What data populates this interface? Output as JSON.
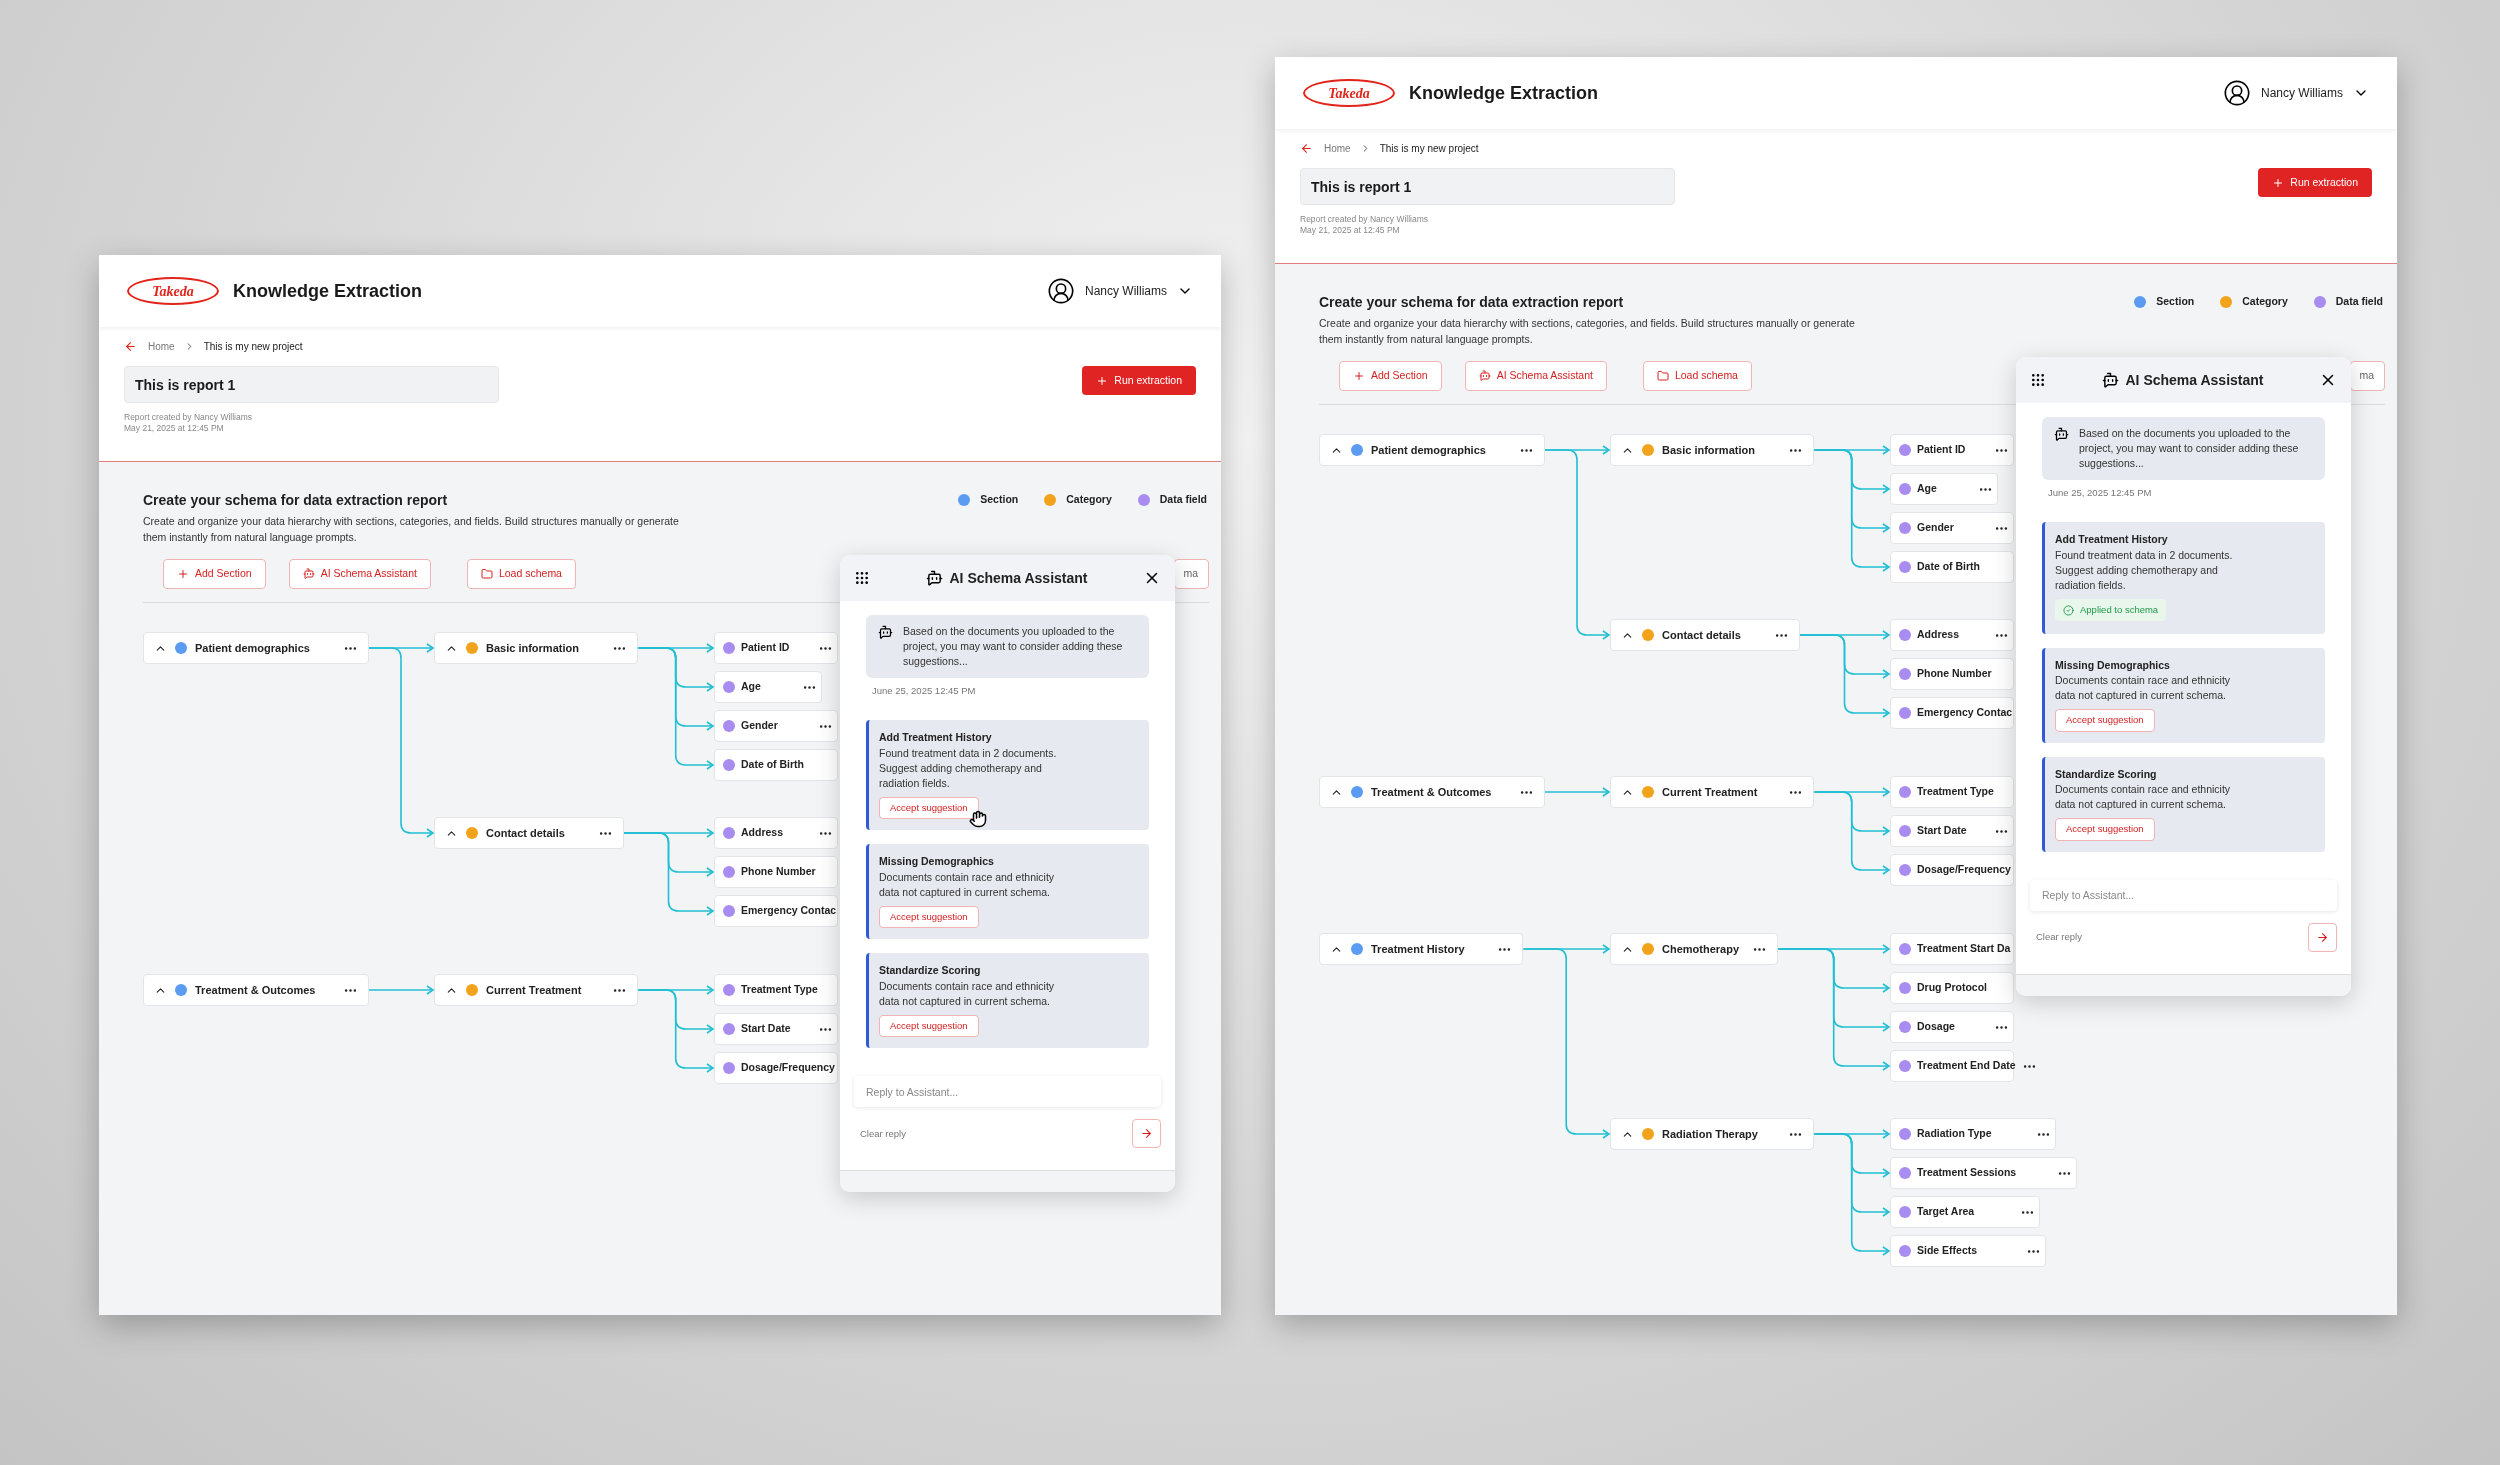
{
  "screens": [
    {
      "logo": "Takeda",
      "app_title": "Knowledge Extraction",
      "user": "Nancy Williams",
      "breadcrumb": [
        "Home",
        "This is my new project"
      ],
      "report_title": "This is report 1",
      "report_meta": [
        "Report created by Nancy Williams",
        "May 21, 2025 at 12:45 PM"
      ],
      "run_button": "Run extraction",
      "schema": {
        "title": "Create your schema for data extraction report",
        "description": "Create and organize your data hierarchy with sections, categories, and fields. Build structures manually or generate them instantly from natural language prompts.",
        "legend": [
          {
            "label": "Section",
            "color": "#5b9cf2"
          },
          {
            "label": "Category",
            "color": "#f2a21b"
          },
          {
            "label": "Data field",
            "color": "#a98cf0"
          }
        ],
        "actions": [
          {
            "kind": "add",
            "label": "Add Section"
          },
          {
            "kind": "assistant",
            "label": "AI Schema Assistant"
          },
          {
            "kind": "load",
            "label": "Load schema"
          },
          {
            "kind": "plain",
            "label": "ma"
          }
        ],
        "tree": [
          {
            "label": "Patient demographics",
            "expanded": true,
            "menu": true,
            "children": [
              {
                "label": "Basic information",
                "expanded": true,
                "menu": true,
                "children": [
                  {
                    "label": "Patient ID",
                    "menu": true
                  },
                  {
                    "label": "Age",
                    "menu": true
                  },
                  {
                    "label": "Gender",
                    "menu": true
                  },
                  {
                    "label": "Date of  Birth",
                    "menu": false
                  }
                ]
              },
              {
                "label": "Contact details",
                "expanded": true,
                "menu": true,
                "children": [
                  {
                    "label": "Address",
                    "menu": true
                  },
                  {
                    "label": "Phone Number",
                    "menu": false
                  },
                  {
                    "label": "Emergency Contac",
                    "menu": false
                  }
                ]
              }
            ]
          },
          {
            "label": "Treatment & Outcomes",
            "expanded": true,
            "menu": true,
            "children": [
              {
                "label": "Current Treatment",
                "expanded": true,
                "menu": true,
                "children": [
                  {
                    "label": "Treatment Type",
                    "menu": false
                  },
                  {
                    "label": "Start Date",
                    "menu": true
                  },
                  {
                    "label": "Dosage/Frequency",
                    "menu": false
                  }
                ]
              }
            ]
          }
        ]
      },
      "assistant": {
        "title": "AI Schema Assistant",
        "message": "Based on the documents you uploaded to the project, you may want to consider adding these suggestions...",
        "time": "June 25, 2025 12:45 PM",
        "suggestions": [
          {
            "title": "Add Treatment History",
            "text": "Found treatment data in 2 documents. Suggest adding chemotherapy and radiation fields.",
            "kind": "accept",
            "action": "Accept suggestion",
            "hovered": true
          },
          {
            "title": "Missing Demographics",
            "text": "Documents contain race and ethnicity data not captured in current schema.",
            "kind": "accept",
            "action": "Accept suggestion",
            "hovered": false
          },
          {
            "title": "Standardize Scoring",
            "text": "Documents contain race and ethnicity data not captured in current schema.",
            "kind": "accept",
            "action": "Accept suggestion",
            "hovered": false
          }
        ],
        "reply_placeholder": "Reply to Assistant...",
        "clear": "Clear reply"
      }
    },
    {
      "logo": "Takeda",
      "app_title": "Knowledge Extraction",
      "user": "Nancy Williams",
      "breadcrumb": [
        "Home",
        "This is my new project"
      ],
      "report_title": "This is report 1",
      "report_meta": [
        "Report created by Nancy Williams",
        "May 21, 2025 at 12:45 PM"
      ],
      "run_button": "Run extraction",
      "schema": {
        "title": "Create your schema for data extraction report",
        "description": "Create and organize your data hierarchy with sections, categories, and fields. Build structures manually or generate them instantly from natural language prompts.",
        "legend": [
          {
            "label": "Section",
            "color": "#5b9cf2"
          },
          {
            "label": "Category",
            "color": "#f2a21b"
          },
          {
            "label": "Data field",
            "color": "#a98cf0"
          }
        ],
        "actions": [
          {
            "kind": "add",
            "label": "Add Section"
          },
          {
            "kind": "assistant",
            "label": "AI Schema Assistant"
          },
          {
            "kind": "load",
            "label": "Load schema"
          },
          {
            "kind": "plain",
            "label": "ma"
          }
        ],
        "tree": [
          {
            "label": "Patient demographics",
            "expanded": true,
            "menu": true,
            "children": [
              {
                "label": "Basic information",
                "expanded": true,
                "menu": true,
                "children": [
                  {
                    "label": "Patient ID",
                    "menu": true
                  },
                  {
                    "label": "Age",
                    "menu": true
                  },
                  {
                    "label": "Gender",
                    "menu": true
                  },
                  {
                    "label": "Date of  Birth",
                    "menu": false
                  }
                ]
              },
              {
                "label": "Contact details",
                "expanded": true,
                "menu": true,
                "children": [
                  {
                    "label": "Address",
                    "menu": true
                  },
                  {
                    "label": "Phone Number",
                    "menu": false
                  },
                  {
                    "label": "Emergency Contac",
                    "menu": false
                  }
                ]
              }
            ]
          },
          {
            "label": "Treatment & Outcomes",
            "expanded": true,
            "menu": true,
            "children": [
              {
                "label": "Current Treatment",
                "expanded": true,
                "menu": true,
                "children": [
                  {
                    "label": "Treatment Type",
                    "menu": false
                  },
                  {
                    "label": "Start Date",
                    "menu": true
                  },
                  {
                    "label": "Dosage/Frequency",
                    "menu": false
                  }
                ]
              }
            ]
          },
          {
            "label": "Treatment History",
            "expanded": true,
            "menu": true,
            "children": [
              {
                "label": "Chemotherapy",
                "expanded": true,
                "menu": true,
                "children": [
                  {
                    "label": "Treatment Start Da",
                    "menu": false
                  },
                  {
                    "label": "Drug Protocol",
                    "menu": false
                  },
                  {
                    "label": "Dosage",
                    "menu": true
                  },
                  {
                    "label": "Treatment End Date",
                    "menu": true
                  }
                ]
              },
              {
                "label": "Radiation Therapy",
                "expanded": true,
                "menu": true,
                "children": [
                  {
                    "label": "Radiation Type",
                    "menu": true
                  },
                  {
                    "label": "Treatment Sessions",
                    "menu": true
                  },
                  {
                    "label": "Target Area",
                    "menu": true
                  },
                  {
                    "label": "Side Effects",
                    "menu": true
                  }
                ]
              }
            ]
          }
        ]
      },
      "assistant": {
        "title": "AI Schema Assistant",
        "message": "Based on the documents you uploaded to the project, you may want to consider adding these suggestions...",
        "time": "June 25, 2025 12:45 PM",
        "suggestions": [
          {
            "title": "Add Treatment History",
            "text": "Found treatment data in 2 documents. Suggest adding chemotherapy and radiation fields.",
            "kind": "applied",
            "action": "Applied to schema",
            "hovered": false
          },
          {
            "title": "Missing Demographics",
            "text": "Documents contain race and ethnicity data not captured in current schema.",
            "kind": "accept",
            "action": "Accept suggestion",
            "hovered": false
          },
          {
            "title": "Standardize Scoring",
            "text": "Documents contain race and ethnicity data not captured in current schema.",
            "kind": "accept",
            "action": "Accept suggestion",
            "hovered": false
          }
        ],
        "reply_placeholder": "Reply to Assistant...",
        "clear": "Clear reply"
      }
    }
  ]
}
